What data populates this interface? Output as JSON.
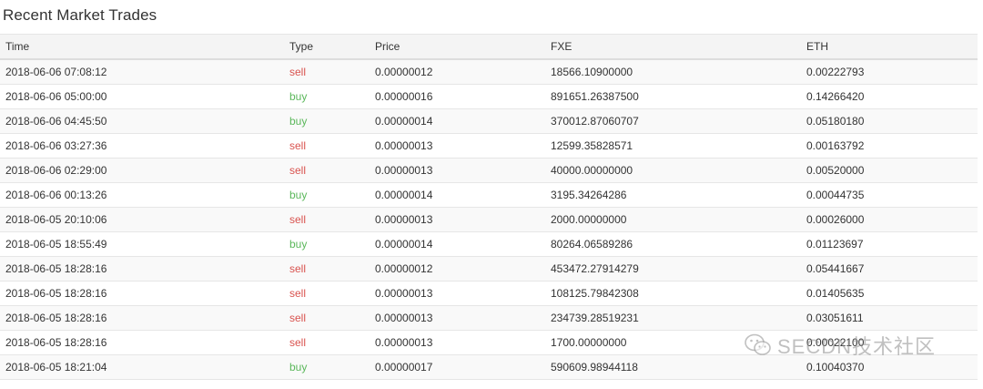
{
  "panel": {
    "title": "Recent Market Trades"
  },
  "table": {
    "headers": {
      "time": "Time",
      "type": "Type",
      "price": "Price",
      "fxe": "FXE",
      "eth": "ETH"
    },
    "rows": [
      {
        "time": "2018-06-06 07:08:12",
        "type": "sell",
        "price": "0.00000012",
        "fxe": "18566.10900000",
        "eth": "0.00222793"
      },
      {
        "time": "2018-06-06 05:00:00",
        "type": "buy",
        "price": "0.00000016",
        "fxe": "891651.26387500",
        "eth": "0.14266420"
      },
      {
        "time": "2018-06-06 04:45:50",
        "type": "buy",
        "price": "0.00000014",
        "fxe": "370012.87060707",
        "eth": "0.05180180"
      },
      {
        "time": "2018-06-06 03:27:36",
        "type": "sell",
        "price": "0.00000013",
        "fxe": "12599.35828571",
        "eth": "0.00163792"
      },
      {
        "time": "2018-06-06 02:29:00",
        "type": "sell",
        "price": "0.00000013",
        "fxe": "40000.00000000",
        "eth": "0.00520000"
      },
      {
        "time": "2018-06-06 00:13:26",
        "type": "buy",
        "price": "0.00000014",
        "fxe": "3195.34264286",
        "eth": "0.00044735"
      },
      {
        "time": "2018-06-05 20:10:06",
        "type": "sell",
        "price": "0.00000013",
        "fxe": "2000.00000000",
        "eth": "0.00026000"
      },
      {
        "time": "2018-06-05 18:55:49",
        "type": "buy",
        "price": "0.00000014",
        "fxe": "80264.06589286",
        "eth": "0.01123697"
      },
      {
        "time": "2018-06-05 18:28:16",
        "type": "sell",
        "price": "0.00000012",
        "fxe": "453472.27914279",
        "eth": "0.05441667"
      },
      {
        "time": "2018-06-05 18:28:16",
        "type": "sell",
        "price": "0.00000013",
        "fxe": "108125.79842308",
        "eth": "0.01405635"
      },
      {
        "time": "2018-06-05 18:28:16",
        "type": "sell",
        "price": "0.00000013",
        "fxe": "234739.28519231",
        "eth": "0.03051611"
      },
      {
        "time": "2018-06-05 18:28:16",
        "type": "sell",
        "price": "0.00000013",
        "fxe": "1700.00000000",
        "eth": "0.00022100"
      },
      {
        "time": "2018-06-05 18:21:04",
        "type": "buy",
        "price": "0.00000017",
        "fxe": "590609.98944118",
        "eth": "0.10040370"
      }
    ]
  },
  "colors": {
    "sell": "#d9534f",
    "buy": "#5cb85c"
  },
  "watermark": {
    "icon": "wechat-icon",
    "text": "SECDN技术社区"
  }
}
